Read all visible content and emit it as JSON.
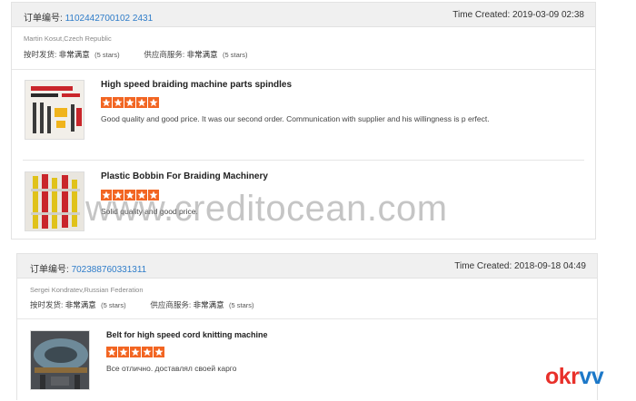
{
  "orders": [
    {
      "order_label": "订单编号:",
      "order_id": "1102442700102 2431",
      "time_created": "Time Created: 2019-03-09 02:38",
      "buyer": "Martin Kosut,Czech Republic",
      "shipping_label": "按时发货:",
      "shipping_value": "非常满意",
      "shipping_stars": "(5 stars)",
      "service_label": "供应商服务:",
      "service_value": "非常满意",
      "service_stars": "(5 stars)",
      "items": [
        {
          "title": "High speed braiding machine parts spindles",
          "rating": 5,
          "review": "Good quality and good price. It was our second order. Communication with supplier and his willingness is p erfect."
        },
        {
          "title": "Plastic Bobbin For Braiding Machinery",
          "rating": 5,
          "review": "Solid quality and good price."
        }
      ]
    },
    {
      "order_label": "订单编号:",
      "order_id": "702388760331311",
      "time_created": "Time Created: 2018-09-18 04:49",
      "buyer": "Sergei Kondratev,Russian Federation",
      "shipping_label": "按时发货:",
      "shipping_value": "非常满意",
      "shipping_stars": "(5 stars)",
      "service_label": "供应商服务:",
      "service_value": "非常满意",
      "service_stars": "(5 stars)",
      "items": [
        {
          "title": "Belt for high speed cord knitting machine",
          "rating": 5,
          "review": "Все отлично. доставлял своей карго"
        }
      ]
    }
  ],
  "watermark": "www.creditocean.com",
  "brand": {
    "part1": "okr",
    "part2": "vv"
  },
  "colors": {
    "star": "#f26522",
    "order_id": "#2e7cc9",
    "header_bg": "#f0f0f0"
  }
}
